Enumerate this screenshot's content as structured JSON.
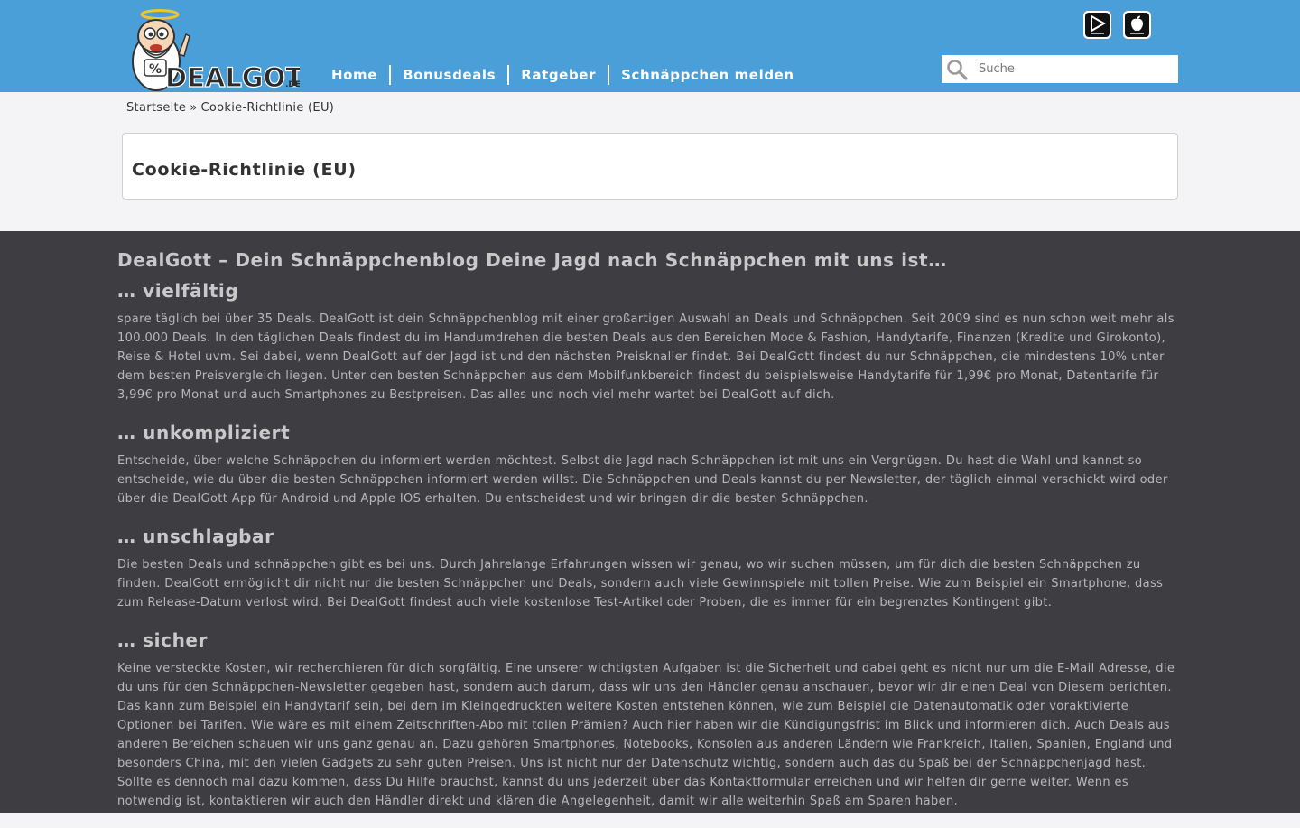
{
  "header": {
    "logo_text": "DEALGOTT",
    "logo_suffix": ".DE",
    "nav": [
      {
        "label": "Home"
      },
      {
        "label": "Bonusdeals"
      },
      {
        "label": "Ratgeber"
      },
      {
        "label": "Schnäppchen melden"
      }
    ],
    "apps": [
      {
        "name": "google-play-icon"
      },
      {
        "name": "app-store-icon"
      }
    ],
    "search": {
      "placeholder": "Suche",
      "value": ""
    }
  },
  "breadcrumb": {
    "home": "Startseite",
    "separator": "»",
    "current": "Cookie-Richtlinie (EU)"
  },
  "page": {
    "title": "Cookie-Richtlinie (EU)"
  },
  "footer": {
    "heading": "DealGott – Dein Schnäppchenblog Deine Jagd nach Schnäppchen mit uns ist…",
    "sections": [
      {
        "title": "… vielfältig",
        "text": "spare täglich bei über 35 Deals. DealGott ist dein Schnäppchenblog mit einer großartigen Auswahl an Deals und Schnäppchen. Seit 2009 sind es nun schon weit mehr als 100.000 Deals. In den täglichen Deals findest du im Handumdrehen die besten Deals aus den Bereichen Mode & Fashion, Handytarife, Finanzen (Kredite und Girokonto), Reise & Hotel uvm. Sei dabei, wenn DealGott auf der Jagd ist und den nächsten Preisknaller findet. Bei DealGott findest du nur Schnäppchen, die mindestens 10% unter dem besten Preisvergleich liegen. Unter den besten Schnäppchen aus dem Mobilfunkbereich findest du beispielsweise Handytarife für 1,99€ pro Monat, Datentarife für 3,99€ pro Monat und auch Smartphones zu Bestpreisen. Das alles und noch viel mehr wartet bei DealGott auf dich."
      },
      {
        "title": "… unkompliziert",
        "text": "Entscheide, über welche Schnäppchen du informiert werden möchtest. Selbst die Jagd nach Schnäppchen ist mit uns ein Vergnügen. Du hast die Wahl und kannst so entscheide, wie du über die besten Schnäppchen informiert werden willst. Die Schnäppchen und Deals kannst du per Newsletter, der täglich einmal verschickt wird oder über die DealGott App für Android und Apple IOS erhalten. Du entscheidest und wir bringen dir die besten Schnäppchen."
      },
      {
        "title": "… unschlagbar",
        "text": "Die besten Deals und schnäppchen gibt es bei uns. Durch Jahrelange Erfahrungen wissen wir genau, wo wir suchen müssen, um für dich die besten Schnäppchen zu finden. DealGott ermöglicht dir nicht nur die besten Schnäppchen und Deals, sondern auch viele Gewinnspiele mit tollen Preise. Wie zum Beispiel ein Smartphone, dass zum Release-Datum verlost wird. Bei DealGott findest auch viele kostenlose Test-Artikel oder Proben, die es immer für ein begrenztes Kontingent gibt."
      },
      {
        "title": "… sicher",
        "text": "Keine versteckte Kosten, wir recherchieren für dich sorgfältig. Eine unserer wichtigsten Aufgaben ist die Sicherheit und dabei geht es nicht nur um die E-Mail Adresse, die du uns für den Schnäppchen-Newsletter gegeben hast, sondern auch darum, dass wir uns den Händler genau anschauen, bevor wir dir einen Deal von Diesem berichten. Das kann zum Beispiel ein Handytarif sein, bei dem im Kleingedruckten weitere Kosten entstehen können, wie zum Beispiel die Datenautomatik oder voraktivierte Optionen bei Tarifen. Wie wäre es mit einem Zeitschriften-Abo mit tollen Prämien? Auch hier haben wir die Kündigungsfrist im Blick und informieren dich. Auch Deals aus anderen Bereichen schauen wir uns ganz genau an. Dazu gehören Smartphones, Notebooks, Konsolen aus anderen Ländern wie Frankreich, Italien, Spanien, England und besonders China, mit den vielen Gadgets zu sehr guten Preisen. Uns ist nicht nur der Datenschutz wichtig, sondern auch das du Spaß bei der Schnäppchenjagd hast. Sollte es dennoch mal dazu kommen, dass Du Hilfe brauchst, kannst du uns jederzeit über das Kontaktformular erreichen und wir helfen dir gerne weiter. Wenn es notwendig ist, kontaktieren wir auch den Händler direkt und klären die Angelegenheit, damit wir alle weiterhin Spaß am Sparen haben."
      }
    ]
  }
}
